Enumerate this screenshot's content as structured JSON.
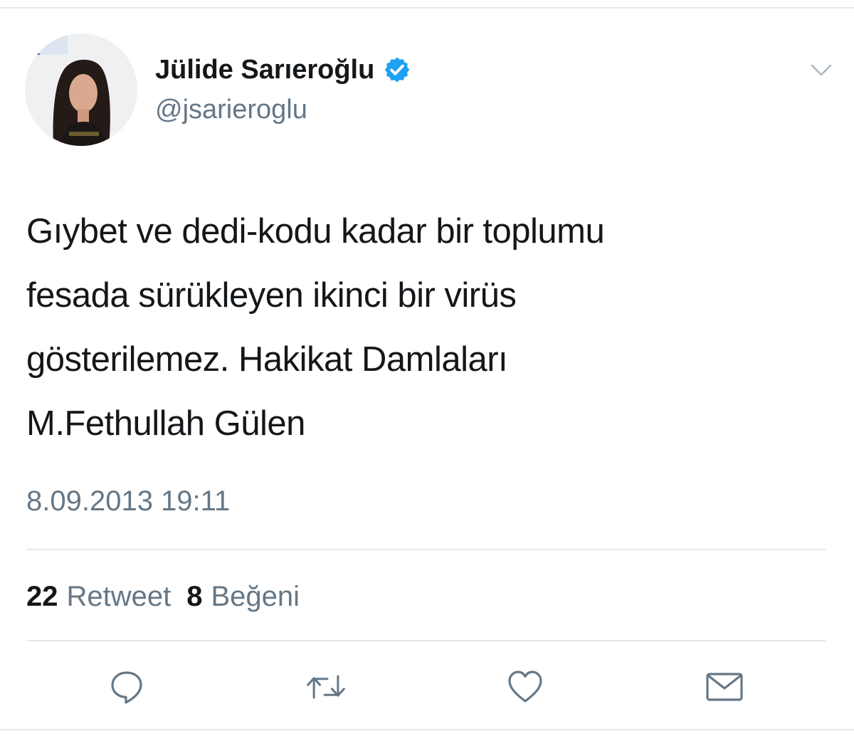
{
  "tweet": {
    "author": {
      "display_name": "Jülide Sarıeroğlu",
      "handle": "@jsarieroglu",
      "verified": true
    },
    "text": "Gıybet ve dedi-kodu kadar bir toplumu\nfesada sürükleyen ikinci bir virüs\ngösterilemez.   Hakikat Damlaları\nM.Fethullah Gülen",
    "timestamp": "8.09.2013 19:11",
    "stats": {
      "retweet_count": "22",
      "retweet_label": "Retweet",
      "like_count": "8",
      "like_label": "Beğeni"
    }
  },
  "icons": {
    "verified": "verified-badge-icon",
    "menu": "chevron-down-icon",
    "reply": "reply-icon",
    "retweet": "retweet-icon",
    "like": "heart-icon",
    "dm": "envelope-icon"
  },
  "colors": {
    "text": "#14171a",
    "secondary": "#657786",
    "verified": "#1da1f2",
    "divider": "#e1e8ed"
  }
}
